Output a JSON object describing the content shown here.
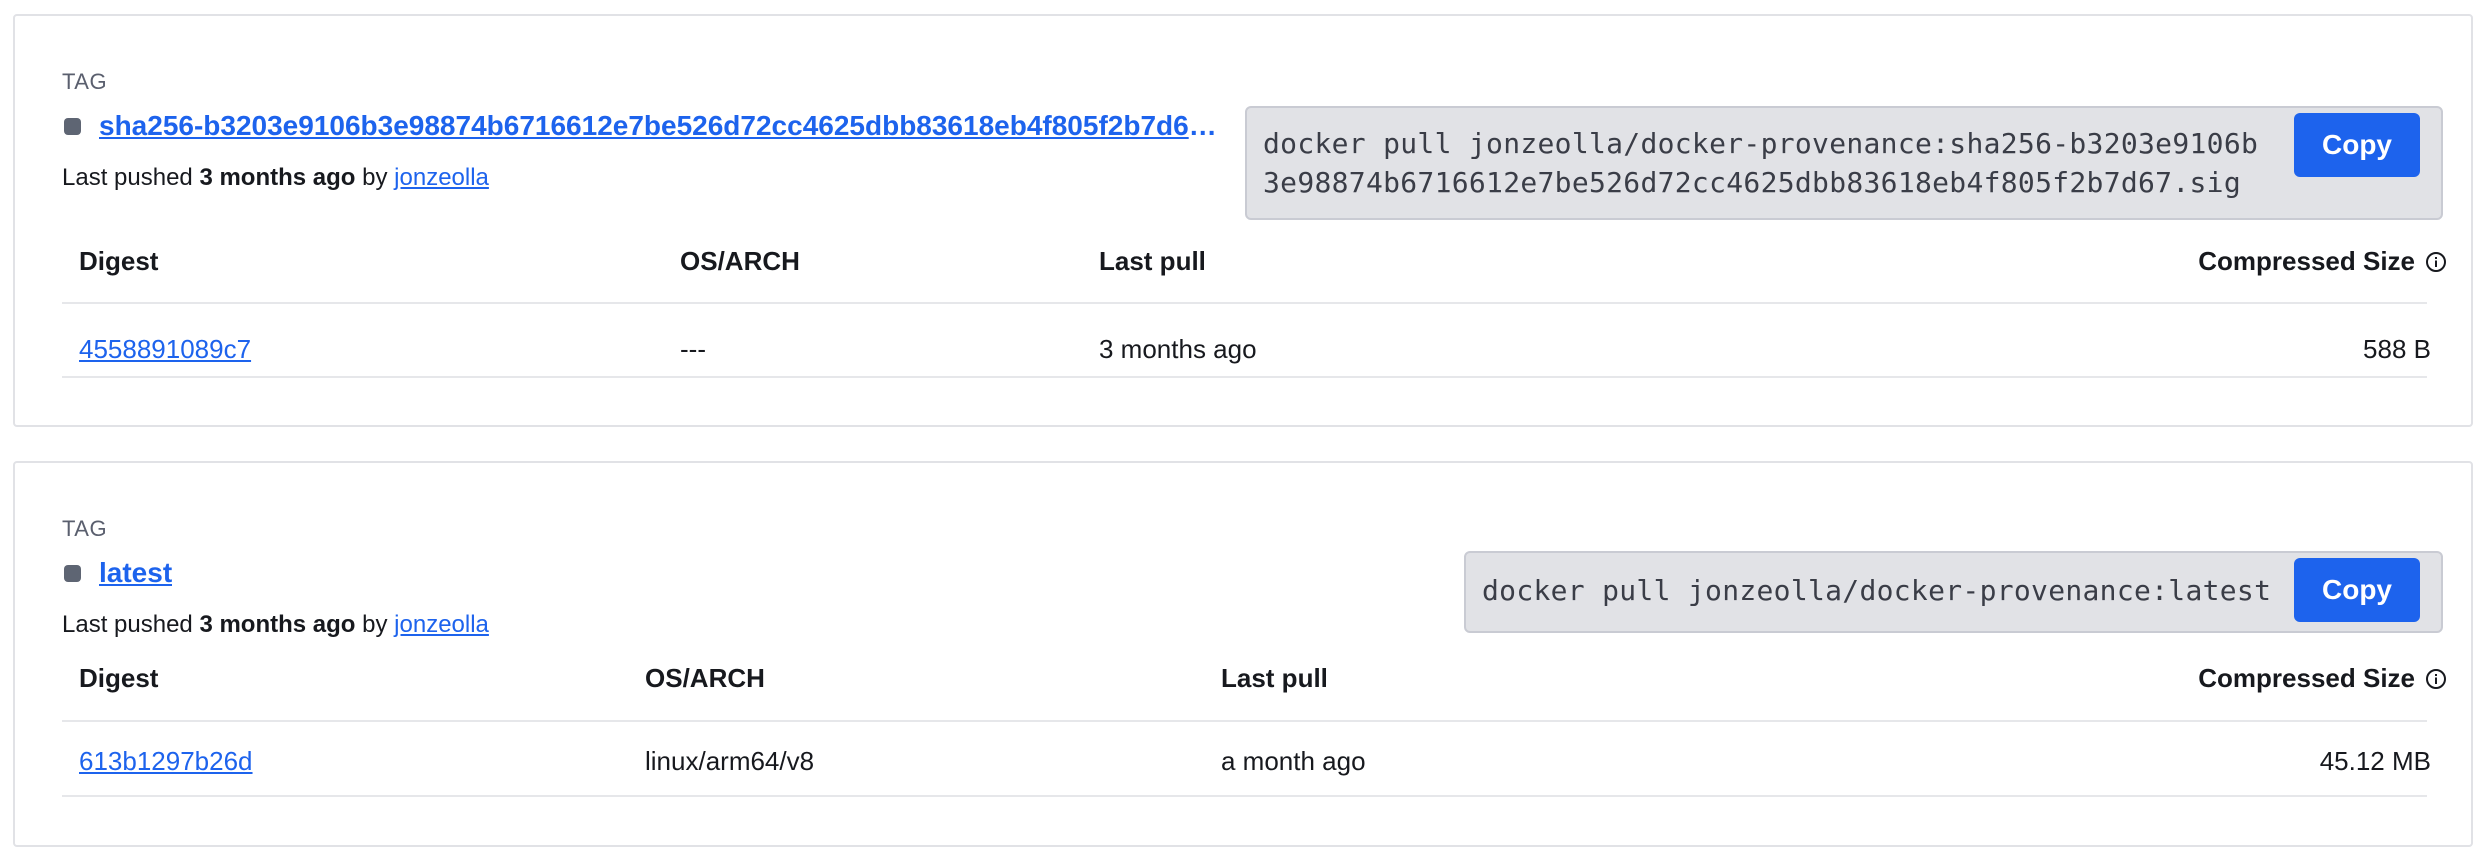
{
  "tags": [
    {
      "section_label": "TAG",
      "name": "sha256-b3203e9106b3e98874b6716612e7be526d72cc4625dbb83618eb4f805f2b7d67.sig",
      "pushed_prefix": "Last pushed",
      "pushed_when": "3 months ago",
      "pushed_by_word": "by",
      "pushed_user": "jonzeolla",
      "pull_command": "docker pull jonzeolla/docker-provenance:sha256-b3203e9106b3e98874b6716612e7be526d72cc4625dbb83618eb4f805f2b7d67.sig",
      "copy_label": "Copy",
      "columns": {
        "digest": "Digest",
        "os_arch": "OS/ARCH",
        "last_pull": "Last pull",
        "compressed_size": "Compressed Size"
      },
      "rows": [
        {
          "digest": "4558891089c7",
          "os_arch": "---",
          "last_pull": "3 months ago",
          "size": "588 B"
        }
      ]
    },
    {
      "section_label": "TAG",
      "name": "latest",
      "pushed_prefix": "Last pushed",
      "pushed_when": "3 months ago",
      "pushed_by_word": "by",
      "pushed_user": "jonzeolla",
      "pull_command": "docker pull jonzeolla/docker-provenance:latest",
      "copy_label": "Copy",
      "columns": {
        "digest": "Digest",
        "os_arch": "OS/ARCH",
        "last_pull": "Last pull",
        "compressed_size": "Compressed Size"
      },
      "rows": [
        {
          "digest": "613b1297b26d",
          "os_arch": "linux/arm64/v8",
          "last_pull": "a month ago",
          "size": "45.12 MB"
        }
      ]
    }
  ],
  "icons": {
    "tag_marker": "square-tag-icon",
    "size_info": "info-circle-icon"
  },
  "colors": {
    "link": "#1d63ed",
    "button": "#1d63ed",
    "command_bg": "#e1e2e6",
    "tag_marker": "#5e6573"
  }
}
